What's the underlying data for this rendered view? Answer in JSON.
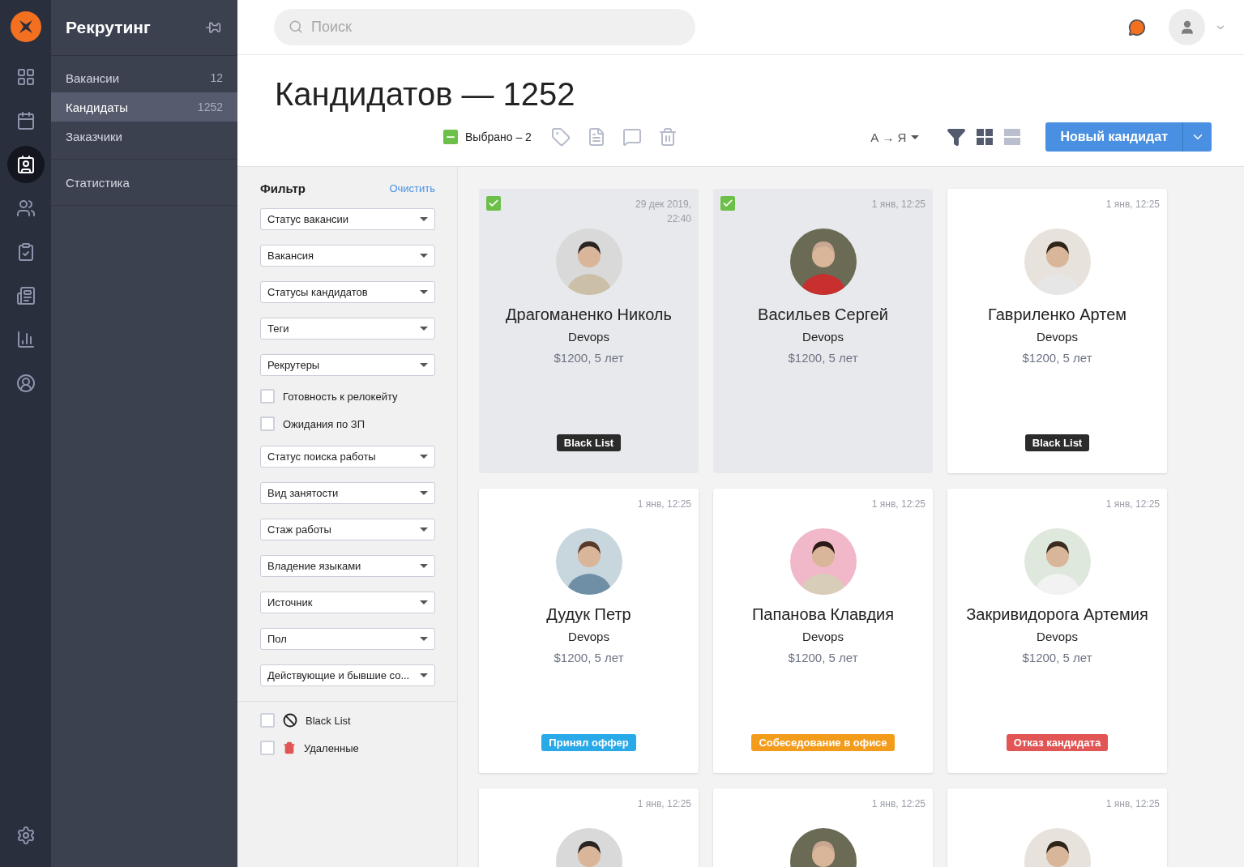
{
  "rail": [
    {
      "selected": false
    },
    {
      "selected": false
    },
    {
      "selected": true
    },
    {
      "selected": false
    },
    {
      "selected": false
    },
    {
      "selected": false
    },
    {
      "selected": false
    },
    {
      "selected": false
    }
  ],
  "nav": {
    "title": "Рекрутинг",
    "groups": [
      [
        {
          "label": "Вакансии",
          "count": "12",
          "selected": false
        },
        {
          "label": "Кандидаты",
          "count": "1252",
          "selected": true
        },
        {
          "label": "Заказчики",
          "selected": false
        }
      ],
      [
        {
          "label": "Статистика",
          "selected": false
        }
      ]
    ]
  },
  "search": {
    "placeholder": "Поиск"
  },
  "page_title": "Кандидатов — 1252",
  "toolbar": {
    "partial_selection": true,
    "selected_label": "Выбрано – 2",
    "sort": "А → Я",
    "views": [
      {
        "selected": true
      },
      {
        "selected": false
      }
    ],
    "new_button": "Новый кандидат"
  },
  "filter": {
    "title": "Фильтр",
    "clear": "Очистить",
    "controls": [
      {
        "kind": "select",
        "label": "Статус вакансии"
      },
      {
        "kind": "select",
        "label": "Вакансия"
      },
      {
        "kind": "select",
        "label": "Статусы кандидатов"
      },
      {
        "kind": "select",
        "label": "Теги"
      },
      {
        "kind": "select",
        "label": "Рекрутеры"
      },
      {
        "kind": "checkbox",
        "label": "Готовность к релокейту",
        "checked": false
      },
      {
        "kind": "checkbox",
        "label": "Ожидания по ЗП",
        "checked": false
      },
      {
        "kind": "select",
        "label": "Статус поиска работы"
      },
      {
        "kind": "select",
        "label": "Вид занятости"
      },
      {
        "kind": "select",
        "label": "Стаж работы"
      },
      {
        "kind": "select",
        "label": "Владение языками"
      },
      {
        "kind": "select",
        "label": "Источник"
      },
      {
        "kind": "select",
        "label": "Пол"
      },
      {
        "kind": "select",
        "label": "Действующие и бывшие со..."
      }
    ],
    "extras": [
      {
        "label": "Black List",
        "checked": false
      },
      {
        "label": "Удаленные",
        "checked": false
      }
    ]
  },
  "cards": [
    {
      "selected": true,
      "date": "29 дек 2019,\n22:40",
      "name": "Драгоманенко Николь",
      "role": "Devops",
      "salary": "$1200, 5 лет",
      "tag": {
        "label": "Black List",
        "color": "#2b2b2b"
      }
    },
    {
      "selected": true,
      "date": "1 янв, 12:25",
      "name": "Васильев Сергей",
      "role": "Devops",
      "salary": "$1200, 5 лет"
    },
    {
      "selected": false,
      "date": "1 янв, 12:25",
      "name": "Гавриленко Артем",
      "role": "Devops",
      "salary": "$1200, 5 лет",
      "tag": {
        "label": "Black List",
        "color": "#2b2b2b"
      }
    },
    {
      "selected": false,
      "date": "1 янв, 12:25",
      "name": "Дудук Петр",
      "role": "Devops",
      "salary": "$1200, 5 лет",
      "tag": {
        "label": "Принял оффер",
        "color": "#29a9e8"
      }
    },
    {
      "selected": false,
      "date": "1 янв, 12:25",
      "name": "Папанова Клавдия",
      "role": "Devops",
      "salary": "$1200, 5 лет",
      "tag": {
        "label": "Собеседование в офисе",
        "color": "#f39c1c"
      }
    },
    {
      "selected": false,
      "date": "1 янв, 12:25",
      "name": "Закривидорога Артемия",
      "role": "Devops",
      "salary": "$1200, 5 лет",
      "tag": {
        "label": "Отказ кандидата",
        "color": "#e25555"
      }
    },
    {
      "selected": false,
      "date": "1 янв, 12:25"
    },
    {
      "selected": false,
      "date": "1 янв, 12:25"
    },
    {
      "selected": false,
      "date": "1 янв, 12:25"
    }
  ]
}
